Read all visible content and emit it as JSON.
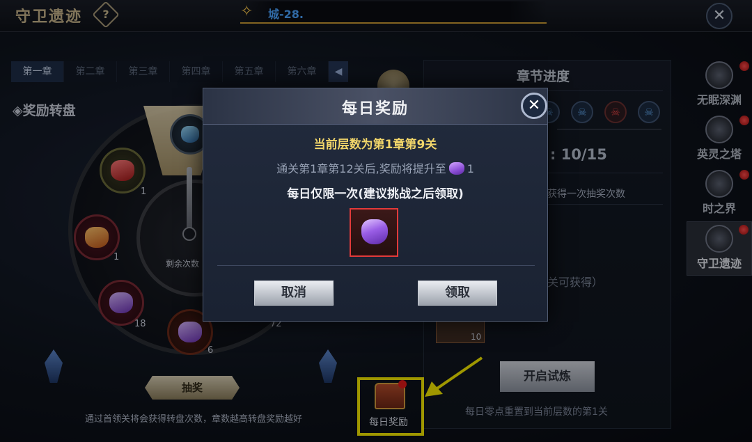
{
  "header": {
    "game_title": "守卫遗迹",
    "help_label": "?",
    "marquee_text": "城-28.",
    "close_label": "✕"
  },
  "chapter_tabs": [
    "第一章",
    "第二章",
    "第三章",
    "第四章",
    "第五章",
    "第六章"
  ],
  "tab_arrow": "◀",
  "wheel": {
    "section_title": "◈奖励转盘",
    "remain_label": "剩余次数",
    "prizes": [
      {
        "count": "1"
      },
      {
        "count": "1"
      },
      {
        "count": "18"
      },
      {
        "count": "6"
      },
      {
        "count": "72"
      }
    ],
    "lottery_button": "抽奖",
    "footer_note": "通过首领关将会获得转盘次数，章数越高转盘奖励越好"
  },
  "progress_panel": {
    "title": "章节进度",
    "progress_text": ": 10/15",
    "line_a": "获得一次抽奖次数",
    "line_b": "关可获得）",
    "reward_count": "10",
    "trial_button": "开启试炼",
    "reset_note": "每日零点重置到当前层数的第1关"
  },
  "sidebar": [
    {
      "label": "无眠深渊",
      "badge": true
    },
    {
      "label": "英灵之塔",
      "badge": true
    },
    {
      "label": "时之界",
      "badge": true
    },
    {
      "label": "守卫遗迹",
      "badge": true,
      "active": true
    }
  ],
  "daily_button": {
    "label": "每日奖励"
  },
  "modal": {
    "title": "每日奖励",
    "close_label": "✕",
    "line1": "当前层数为第1章第9关",
    "line2_prefix": "通关第1章第12关后,奖励将提升至",
    "line2_suffix": "1",
    "line3": "每日仅限一次(建议挑战之后领取)",
    "cancel_button": "取消",
    "claim_button": "领取"
  },
  "colors": {
    "accent_gold": "#f2d66a",
    "highlight_box": "#f4e800",
    "item_border": "#e23a3a",
    "gem_purple": "#9a5ee6"
  },
  "icons": {
    "top_close": "close-icon",
    "help": "help-icon",
    "chest": "treasure-chest-icon",
    "gem": "purple-gem-icon"
  }
}
